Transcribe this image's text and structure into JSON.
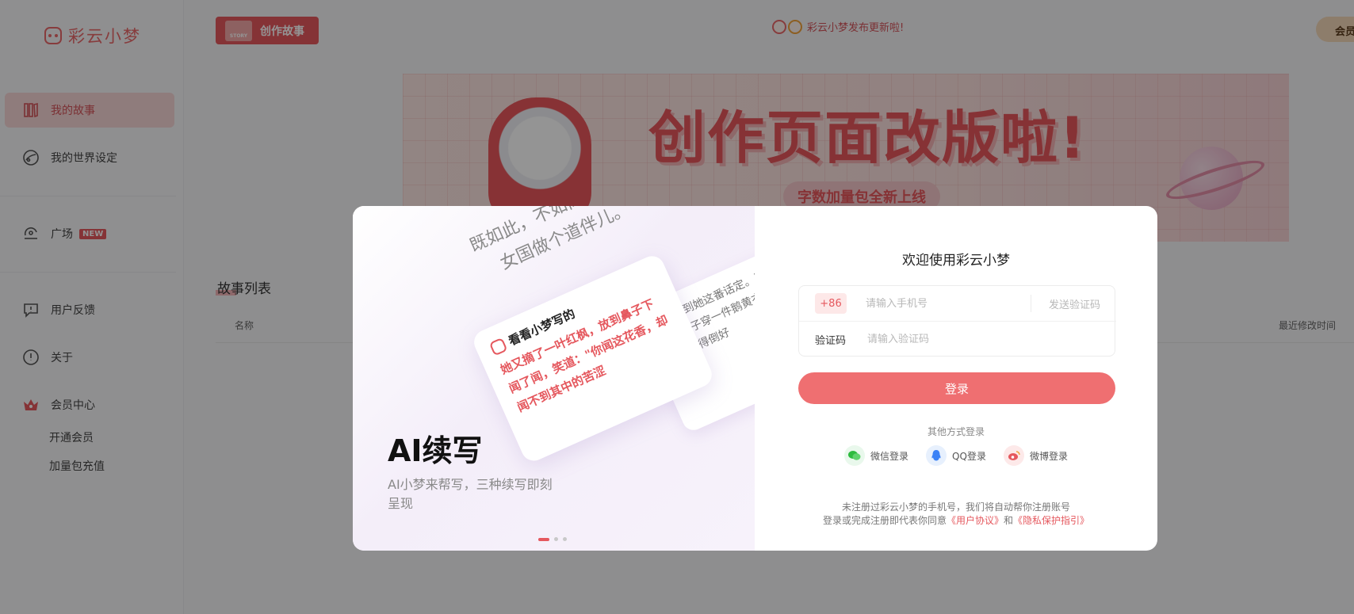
{
  "sidebar": {
    "logo_text": "彩云小梦",
    "items": [
      {
        "label": "我的故事",
        "icon": "books-icon"
      },
      {
        "label": "我的世界设定",
        "icon": "globe-icon"
      },
      {
        "label": "广场",
        "icon": "plaza-icon",
        "badge": "NEW"
      },
      {
        "label": "用户反馈",
        "icon": "feedback-icon"
      },
      {
        "label": "关于",
        "icon": "info-icon"
      },
      {
        "label": "会员中心",
        "icon": "crown-icon"
      }
    ],
    "sub_items": [
      "开通会员",
      "加量包充值"
    ]
  },
  "header": {
    "create_button": "创作故事",
    "create_chip": "STORY",
    "announcement": "彩云小梦发布更新啦!",
    "member_pill": "会员"
  },
  "banner": {
    "title": "创作页面改版啦!",
    "subtitle": "字数加量包全新上线"
  },
  "story_list": {
    "title": "故事列表",
    "columns": {
      "name": "名称",
      "last_modified": "最近修改时间"
    }
  },
  "modal": {
    "carousel": {
      "bg_quote_line1": "既如此，不如离了这贾府，",
      "bg_quote_line2": "女国做个道伴儿。",
      "side_card_text": "黛玉听到她这番话定。只见这女子穿一件鹅黄衣裙，生得倒好",
      "card_header": "看看小梦写的",
      "card_body": "她又摘了一叶红枫，放到鼻子下闻了闻，笑道：\"你闻这花香，却闻不到其中的苦涩",
      "feature_title": "AI续写",
      "feature_desc": "AI小梦来帮写，三种续写即刻呈现",
      "slide_count": 3,
      "active_slide": 1
    },
    "login": {
      "welcome": "欢迎使用彩云小梦",
      "country_code": "+86",
      "phone_placeholder": "请输入手机号",
      "send_code": "发送验证码",
      "code_label": "验证码",
      "code_placeholder": "请输入验证码",
      "login_button": "登录",
      "other_methods": "其他方式登录",
      "socials": [
        {
          "label": "微信登录",
          "icon": "wechat-icon",
          "color": "#2dbb3f"
        },
        {
          "label": "QQ登录",
          "icon": "qq-icon",
          "color": "#3b82f6"
        },
        {
          "label": "微博登录",
          "icon": "weibo-icon",
          "color": "#e5585e"
        }
      ],
      "agreement_line1": "未注册过彩云小梦的手机号，我们将自动帮你注册账号",
      "agreement_prefix": "登录或完成注册即代表你同意",
      "user_agreement": "《用户协议》",
      "and": "和",
      "privacy_policy": "《隐私保护指引》"
    }
  },
  "colors": {
    "accent": "#e5585e",
    "login_button": "#ef6f71",
    "overlay": "rgba(0,0,0,0.42)"
  }
}
